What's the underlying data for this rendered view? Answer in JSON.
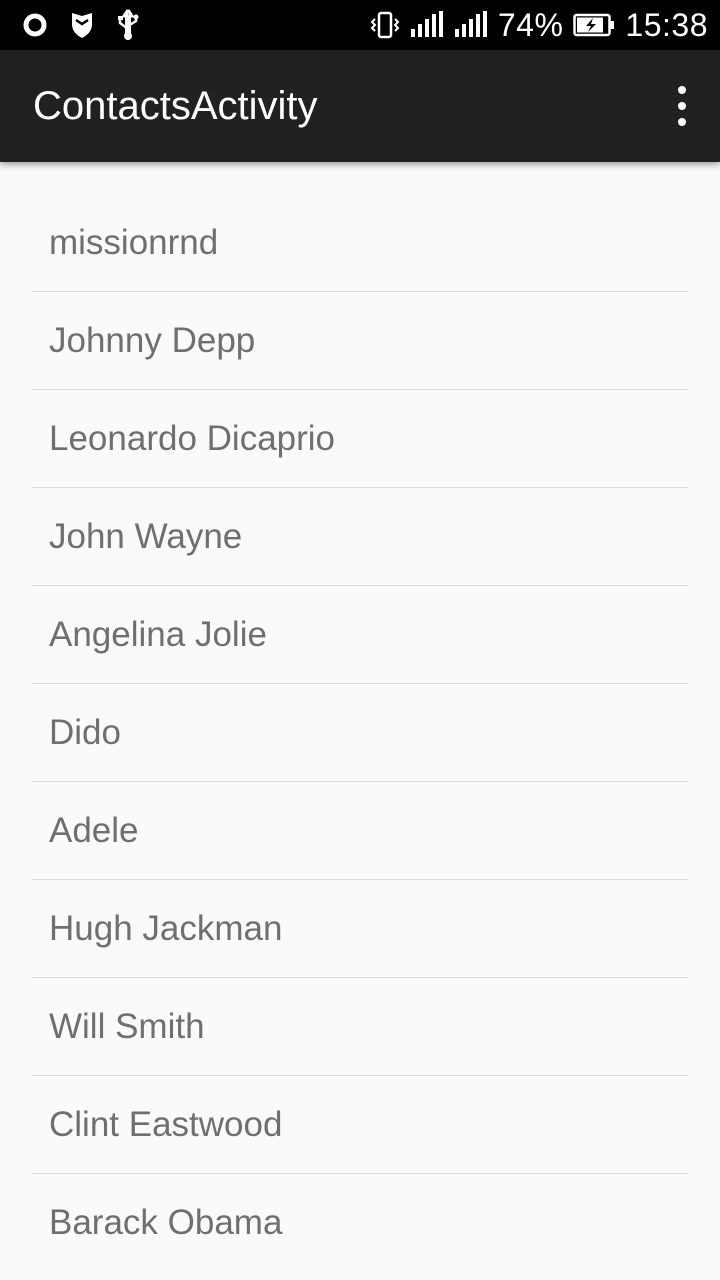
{
  "status_bar": {
    "left_icons": [
      "notification-ring-icon",
      "shield-icon",
      "usb-icon"
    ],
    "right_icons": [
      "vibrate-icon",
      "signal-icon",
      "signal-icon",
      "battery-charging-icon"
    ],
    "battery": "74%",
    "time": "15:38"
  },
  "app_bar": {
    "title": "ContactsActivity",
    "menu_icon": "more-vertical-icon"
  },
  "contacts": [
    "missionrnd",
    "Johnny Depp",
    "Leonardo Dicaprio",
    "John Wayne",
    "Angelina Jolie",
    "Dido",
    "Adele",
    "Hugh Jackman",
    "Will Smith",
    "Clint Eastwood",
    "Barack Obama"
  ],
  "colors": {
    "status_bar": "#000000",
    "app_bar": "#212121",
    "background": "#fafafa",
    "text": "#6f6f6f",
    "divider": "#dcdcdc"
  }
}
